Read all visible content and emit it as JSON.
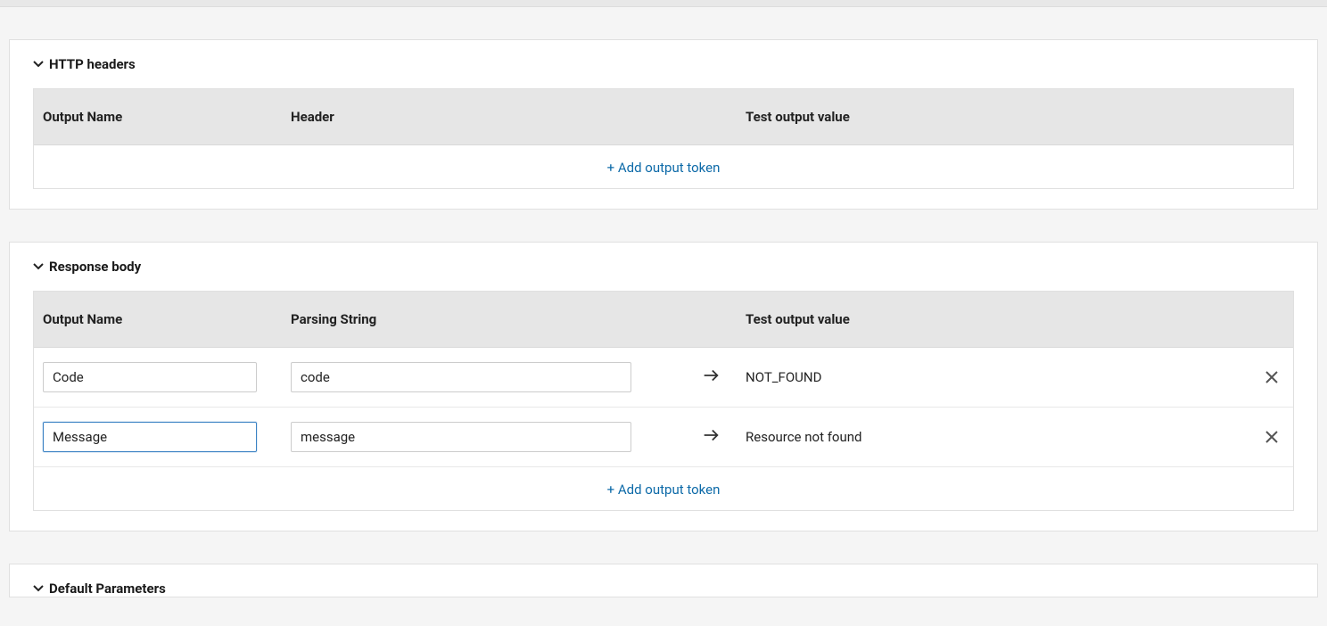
{
  "sections": {
    "http_headers": {
      "title": "HTTP headers",
      "columns": {
        "name": "Output Name",
        "second": "Header",
        "value": "Test output value"
      },
      "add_label": "+ Add output token"
    },
    "response_body": {
      "title": "Response body",
      "columns": {
        "name": "Output Name",
        "second": "Parsing String",
        "value": "Test output value"
      },
      "rows": [
        {
          "name": "Code",
          "parse": "code",
          "value": "NOT_FOUND"
        },
        {
          "name": "Message",
          "parse": "message",
          "value": "Resource not found"
        }
      ],
      "add_label": "+ Add output token"
    },
    "default_params": {
      "title": "Default Parameters"
    }
  }
}
